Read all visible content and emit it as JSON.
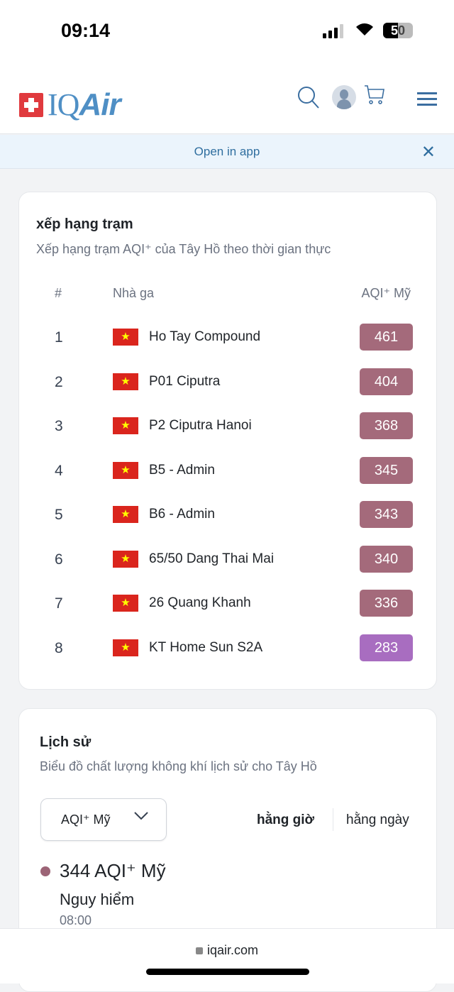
{
  "status_bar": {
    "time": "09:14",
    "battery": "50",
    "battery_level": 50
  },
  "header": {
    "logo": "IQAir",
    "logo_prefix": "IQ",
    "logo_suffix": "Air"
  },
  "banner": {
    "text": "Open in app"
  },
  "ranking": {
    "title": "xếp hạng trạm",
    "subtitle": "Xếp hạng trạm AQI⁺ của Tây Hồ theo thời gian thực",
    "columns": [
      "#",
      "Nhà ga",
      "AQI⁺ Mỹ"
    ],
    "rows": [
      {
        "rank": "1",
        "name": "Ho Tay Compound",
        "aqi": "461",
        "color": "#a46a7b"
      },
      {
        "rank": "2",
        "name": "P01 Ciputra",
        "aqi": "404",
        "color": "#a46a7b"
      },
      {
        "rank": "3",
        "name": "P2 Ciputra Hanoi",
        "aqi": "368",
        "color": "#a46a7b"
      },
      {
        "rank": "4",
        "name": "B5 - Admin",
        "aqi": "345",
        "color": "#a46a7b"
      },
      {
        "rank": "5",
        "name": "B6 - Admin",
        "aqi": "343",
        "color": "#a46a7b"
      },
      {
        "rank": "6",
        "name": "65/50 Dang Thai Mai",
        "aqi": "340",
        "color": "#a46a7b"
      },
      {
        "rank": "7",
        "name": "26 Quang Khanh",
        "aqi": "336",
        "color": "#a46a7b"
      },
      {
        "rank": "8",
        "name": "KT Home Sun S2A",
        "aqi": "283",
        "color": "#a86dc0"
      }
    ]
  },
  "history": {
    "title": "Lịch sử",
    "subtitle": "Biểu đồ chất lượng không khí lịch sử cho Tây Hồ",
    "select_value": "AQI⁺ Mỹ",
    "tabs": [
      "hằng giờ",
      "hằng ngày"
    ],
    "active_tab": "hằng giờ",
    "current": {
      "value": "344 AQI⁺ Mỹ",
      "level": "Nguy hiểm",
      "time": "08:00",
      "color": "#9c6476"
    }
  },
  "browser": {
    "url": "iqair.com"
  }
}
